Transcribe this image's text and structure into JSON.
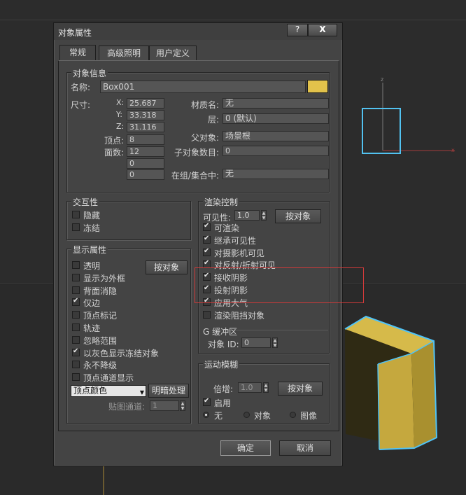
{
  "dialog": {
    "title": "对象属性",
    "help": "?",
    "close": "X"
  },
  "tabs": [
    "常规",
    "高级照明",
    "用户定义"
  ],
  "object_info": {
    "legend": "对象信息",
    "name_label": "名称:",
    "name_value": "Box001",
    "swatch_color": "#e2c24b",
    "dims_label": "尺寸:",
    "x_label": "X:",
    "x_value": "25.687",
    "y_label": "Y:",
    "y_value": "33.318",
    "z_label": "Z:",
    "z_value": "31.116",
    "vertices_label": "顶点:",
    "vertices_value": "8",
    "faces_label": "面数:",
    "faces_value": "12",
    "extra1": "0",
    "extra2": "0",
    "material_label": "材质名:",
    "material_value": "无",
    "layer_label": "层:",
    "layer_value": "0 (默认)",
    "parent_label": "父对象:",
    "parent_value": "场景根",
    "children_label": "子对象数目:",
    "children_value": "0",
    "group_label": "在组/集合中:",
    "group_value": "无"
  },
  "interactivity": {
    "legend": "交互性",
    "items": [
      {
        "label": "隐藏",
        "checked": false
      },
      {
        "label": "冻结",
        "checked": false
      }
    ]
  },
  "display": {
    "legend": "显示属性",
    "by_object": "按对象",
    "items": [
      {
        "label": "透明",
        "checked": false
      },
      {
        "label": "显示为外框",
        "checked": false
      },
      {
        "label": "背面消隐",
        "checked": false
      },
      {
        "label": "仅边",
        "checked": true
      },
      {
        "label": "顶点标记",
        "checked": false
      },
      {
        "label": "轨迹",
        "checked": false
      },
      {
        "label": "忽略范围",
        "checked": false
      },
      {
        "label": "以灰色显示冻结对象",
        "checked": true
      },
      {
        "label": "永不降级",
        "checked": false
      },
      {
        "label": "顶点通道显示",
        "checked": false
      }
    ],
    "vertex_color": "顶点颜色",
    "shading": "明暗处理",
    "map_channel_label": "贴图通道:",
    "map_channel_value": "1"
  },
  "render": {
    "legend": "渲染控制",
    "visibility_label": "可见性:",
    "visibility_value": "1.0",
    "by_object": "按对象",
    "items": [
      {
        "label": "可渲染",
        "checked": true
      },
      {
        "label": "继承可见性",
        "checked": true
      },
      {
        "label": "对摄影机可见",
        "checked": true
      },
      {
        "label": "对反射/折射可见",
        "checked": true
      },
      {
        "label": "接收阴影",
        "checked": true
      },
      {
        "label": "投射阴影",
        "checked": true
      },
      {
        "label": "应用大气",
        "checked": true
      },
      {
        "label": "渲染阻挡对象",
        "checked": false
      }
    ],
    "gbuffer_legend": "G 缓冲区",
    "object_id_label": "对象 ID:",
    "object_id_value": "0"
  },
  "motion_blur": {
    "legend": "运动模糊",
    "multiplier_label": "倍增:",
    "multiplier_value": "1.0",
    "by_object": "按对象",
    "enable_label": "启用",
    "enable_checked": true,
    "radios": [
      {
        "label": "无",
        "selected": true
      },
      {
        "label": "对象",
        "selected": false
      },
      {
        "label": "图像",
        "selected": false
      }
    ]
  },
  "footer": {
    "ok": "确定",
    "cancel": "取消"
  },
  "colors": {
    "highlight": "#d23a3a",
    "box_face": "#c8aa3c",
    "selection": "#4fc3f7"
  }
}
